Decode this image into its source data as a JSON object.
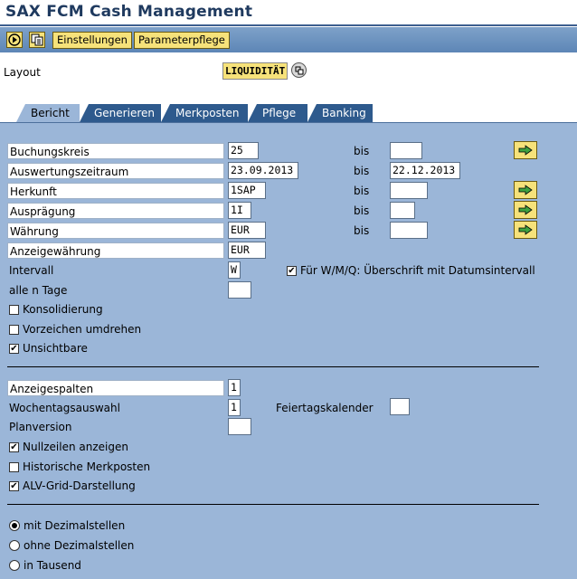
{
  "window": {
    "title": "SAX FCM Cash Management"
  },
  "toolbar": {
    "execute_icon": "execute-icon",
    "variant_icon": "variant-icon",
    "btn_einstellungen": "Einstellungen",
    "btn_parameterpflege": "Parameterpflege"
  },
  "layout": {
    "label": "Layout",
    "value": "LIQUIDITÄT"
  },
  "tabs": [
    {
      "label": "Bericht"
    },
    {
      "label": "Generieren"
    },
    {
      "label": "Merkposten"
    },
    {
      "label": "Pflege"
    },
    {
      "label": "Banking"
    }
  ],
  "fields": {
    "buchungskreis": {
      "label": "Buchungskreis",
      "from": "25",
      "to": ""
    },
    "auswertungszeitraum": {
      "label": "Auswertungszeitraum",
      "from": "23.09.2013",
      "to": "22.12.2013"
    },
    "herkunft": {
      "label": "Herkunft",
      "from": "1SAP",
      "to": ""
    },
    "auspraegung": {
      "label": "Ausprägung",
      "from": "1I",
      "to": ""
    },
    "waehrung": {
      "label": "Währung",
      "from": "EUR",
      "to": ""
    },
    "anzeigewaehrung": {
      "label": "Anzeigewährung",
      "value": "EUR"
    },
    "intervall": {
      "label": "Intervall",
      "value": "W"
    },
    "alle_n_tage": {
      "label": "alle n Tage",
      "value": ""
    },
    "bis_label": "bis"
  },
  "checks1": {
    "ueberschrift": {
      "label": "Für W/M/Q: Überschrift mit Datumsintervall",
      "checked": true
    },
    "konsolidierung": {
      "label": "Konsolidierung",
      "checked": false
    },
    "vorzeichen": {
      "label": "Vorzeichen umdrehen",
      "checked": false
    },
    "unsichtbare": {
      "label": "Unsichtbare",
      "checked": true
    }
  },
  "section2": {
    "anzeigespalten": {
      "label": "Anzeigespalten",
      "value": "1"
    },
    "wochentagsauswahl": {
      "label": "Wochentagsauswahl",
      "value": "1"
    },
    "feiertagskalender": {
      "label": "Feiertagskalender",
      "value": ""
    },
    "planversion": {
      "label": "Planversion",
      "value": ""
    },
    "nullzeilen": {
      "label": "Nullzeilen anzeigen",
      "checked": true
    },
    "historische": {
      "label": "Historische Merkposten",
      "checked": false
    },
    "alv": {
      "label": "ALV-Grid-Darstellung",
      "checked": true
    }
  },
  "radios": {
    "mit": {
      "label": "mit Dezimalstellen",
      "selected": true
    },
    "ohne": {
      "label": "ohne Dezimalstellen",
      "selected": false
    },
    "tausend": {
      "label": "in Tausend",
      "selected": false
    }
  },
  "colors": {
    "panel": "#9bb6d8",
    "tab_inactive": "#2e5a8d",
    "title": "#1f3a5f",
    "button_yellow": "#f6e27a"
  }
}
